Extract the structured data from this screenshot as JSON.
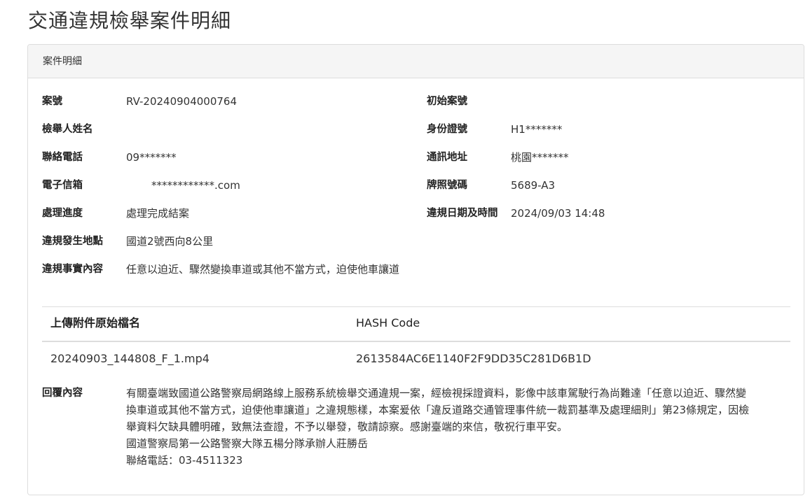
{
  "page": {
    "title": "交通違規檢舉案件明細"
  },
  "panel": {
    "heading": "案件明細"
  },
  "fields": {
    "case_no": {
      "label": "案號",
      "value": "RV-20240904000764"
    },
    "original_case_no": {
      "label": "初始案號",
      "value": ""
    },
    "reporter_name": {
      "label": "檢舉人姓名",
      "value": ""
    },
    "id_no": {
      "label": "身份證號",
      "value": "H1*******"
    },
    "phone": {
      "label": "聯絡電話",
      "value": "09*******"
    },
    "address": {
      "label": "通訊地址",
      "value": "桃園*******"
    },
    "email": {
      "label": "電子信箱",
      "value": "************.com"
    },
    "plate": {
      "label": "牌照號碼",
      "value": "5689-A3"
    },
    "status": {
      "label": "處理進度",
      "value": "處理完成結案"
    },
    "violation_time": {
      "label": "違規日期及時間",
      "value": "2024/09/03 14:48"
    },
    "location": {
      "label": "違規發生地點",
      "value": "國道2號西向8公里"
    },
    "facts": {
      "label": "違規事實內容",
      "value": "任意以迫近、驟然變換車道或其他不當方式，迫使他車讓道"
    }
  },
  "attachments": {
    "headers": {
      "filename": "上傳附件原始檔名",
      "hash": "HASH Code"
    },
    "rows": [
      {
        "filename": "20240903_144808_F_1.mp4",
        "hash": "2613584AC6E1140F2F9DD35C281D6B1D"
      }
    ]
  },
  "reply": {
    "label": "回覆內容",
    "lines": [
      "有關臺端致國道公路警察局網路線上服務系統檢舉交通違規一案，經檢視採證資料，影像中該車駕駛行為尚難達「任意以迫近、驟然變",
      "換車道或其他不當方式，迫使他車讓道」之違規態樣，本案爰依「違反道路交通管理事件統一裁罰基準及處理細則」第23條規定，因檢",
      "舉資料欠缺具體明確，致無法查證，不予以舉發，敬請諒察。感謝臺端的來信，敬祝行車平安。",
      "國道警察局第一公路警察大隊五楊分隊承辦人莊勝岳",
      "聯絡電話：03-4511323"
    ]
  }
}
